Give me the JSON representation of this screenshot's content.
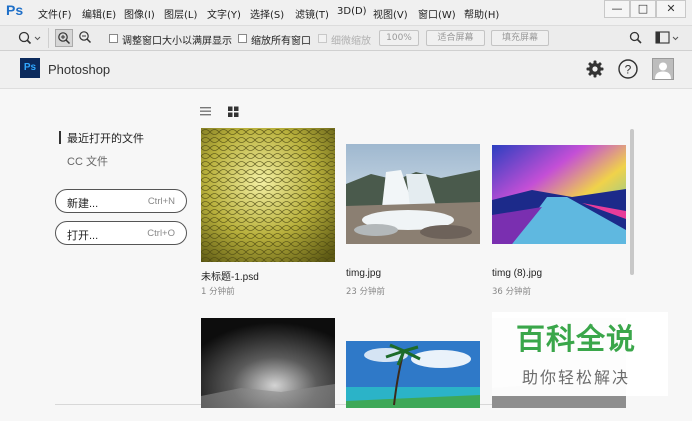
{
  "app": {
    "logo": "Ps",
    "title": "Photoshop"
  },
  "menu": [
    "文件(F)",
    "编辑(E)",
    "图像(I)",
    "图层(L)",
    "文字(Y)",
    "选择(S)",
    "滤镜(T)",
    "3D(D)",
    "视图(V)",
    "窗口(W)",
    "帮助(H)"
  ],
  "window_controls": {
    "minimize": "—",
    "maximize": "□",
    "close": "✕"
  },
  "options_bar": {
    "resize_windows": "调整窗口大小以满屏显示",
    "zoom_all": "缩放所有窗口",
    "scrubby_zoom": "细微缩放",
    "zoom_percent": "100%",
    "fit_screen": "适合屏幕",
    "fill_screen": "填充屏幕"
  },
  "sidebar": {
    "recent": "最近打开的文件",
    "cc_files": "CC 文件",
    "new_label": "新建...",
    "new_shortcut": "Ctrl+N",
    "open_label": "打开...",
    "open_shortcut": "Ctrl+O"
  },
  "files": [
    {
      "name": "未标题-1.psd",
      "time": "1 分钟前"
    },
    {
      "name": "timg.jpg",
      "time": "23 分钟前"
    },
    {
      "name": "timg (8).jpg",
      "time": "36 分钟前"
    },
    {
      "name": "",
      "time": ""
    },
    {
      "name": "",
      "time": ""
    },
    {
      "name": "",
      "time": ""
    }
  ],
  "watermark": {
    "title": "百科全说",
    "subtitle": "助你轻松解决"
  },
  "colors": {
    "accent": "#31a8ff",
    "ps_bg": "#0b2a5c",
    "watermark_green": "#3aa64a"
  }
}
